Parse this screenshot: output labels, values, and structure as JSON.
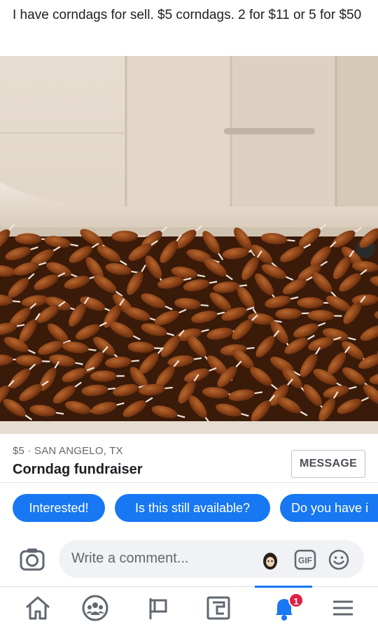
{
  "post": {
    "text": "I have corndags for sell. $5 corndags. 2 for $11 or 5 for $50"
  },
  "listing": {
    "meta": "$5 · SAN ANGELO, TX",
    "title": "Corndag fundraiser",
    "message_label": "MESSAGE"
  },
  "quick_replies": [
    {
      "label": "Interested!"
    },
    {
      "label": "Is this still available?"
    },
    {
      "label": "Do you have i"
    }
  ],
  "comment": {
    "placeholder": "Write a comment...",
    "gif_label": "GIF"
  },
  "nav": {
    "notifications_badge": "1",
    "active_tab": "notifications"
  },
  "colors": {
    "accent": "#1877f2",
    "badge": "#e41e3f"
  },
  "icons": [
    "camera-icon",
    "avatar-sticker-icon",
    "gif-icon",
    "emoji-icon",
    "home-icon",
    "groups-icon",
    "pages-flag-icon",
    "news-feed-icon",
    "notifications-bell-icon",
    "menu-icon"
  ]
}
